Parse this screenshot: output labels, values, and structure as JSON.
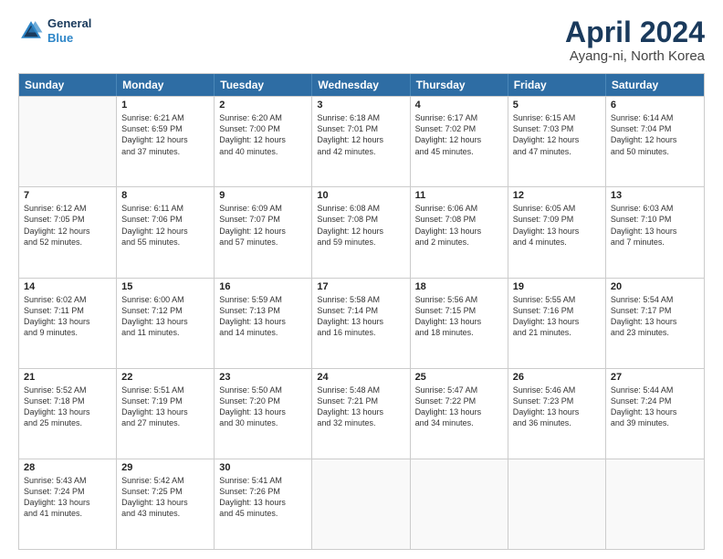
{
  "header": {
    "logo_line1": "General",
    "logo_line2": "Blue",
    "title": "April 2024",
    "subtitle": "Ayang-ni, North Korea"
  },
  "weekdays": [
    "Sunday",
    "Monday",
    "Tuesday",
    "Wednesday",
    "Thursday",
    "Friday",
    "Saturday"
  ],
  "weeks": [
    [
      {
        "day": "",
        "lines": []
      },
      {
        "day": "1",
        "lines": [
          "Sunrise: 6:21 AM",
          "Sunset: 6:59 PM",
          "Daylight: 12 hours",
          "and 37 minutes."
        ]
      },
      {
        "day": "2",
        "lines": [
          "Sunrise: 6:20 AM",
          "Sunset: 7:00 PM",
          "Daylight: 12 hours",
          "and 40 minutes."
        ]
      },
      {
        "day": "3",
        "lines": [
          "Sunrise: 6:18 AM",
          "Sunset: 7:01 PM",
          "Daylight: 12 hours",
          "and 42 minutes."
        ]
      },
      {
        "day": "4",
        "lines": [
          "Sunrise: 6:17 AM",
          "Sunset: 7:02 PM",
          "Daylight: 12 hours",
          "and 45 minutes."
        ]
      },
      {
        "day": "5",
        "lines": [
          "Sunrise: 6:15 AM",
          "Sunset: 7:03 PM",
          "Daylight: 12 hours",
          "and 47 minutes."
        ]
      },
      {
        "day": "6",
        "lines": [
          "Sunrise: 6:14 AM",
          "Sunset: 7:04 PM",
          "Daylight: 12 hours",
          "and 50 minutes."
        ]
      }
    ],
    [
      {
        "day": "7",
        "lines": [
          "Sunrise: 6:12 AM",
          "Sunset: 7:05 PM",
          "Daylight: 12 hours",
          "and 52 minutes."
        ]
      },
      {
        "day": "8",
        "lines": [
          "Sunrise: 6:11 AM",
          "Sunset: 7:06 PM",
          "Daylight: 12 hours",
          "and 55 minutes."
        ]
      },
      {
        "day": "9",
        "lines": [
          "Sunrise: 6:09 AM",
          "Sunset: 7:07 PM",
          "Daylight: 12 hours",
          "and 57 minutes."
        ]
      },
      {
        "day": "10",
        "lines": [
          "Sunrise: 6:08 AM",
          "Sunset: 7:08 PM",
          "Daylight: 12 hours",
          "and 59 minutes."
        ]
      },
      {
        "day": "11",
        "lines": [
          "Sunrise: 6:06 AM",
          "Sunset: 7:08 PM",
          "Daylight: 13 hours",
          "and 2 minutes."
        ]
      },
      {
        "day": "12",
        "lines": [
          "Sunrise: 6:05 AM",
          "Sunset: 7:09 PM",
          "Daylight: 13 hours",
          "and 4 minutes."
        ]
      },
      {
        "day": "13",
        "lines": [
          "Sunrise: 6:03 AM",
          "Sunset: 7:10 PM",
          "Daylight: 13 hours",
          "and 7 minutes."
        ]
      }
    ],
    [
      {
        "day": "14",
        "lines": [
          "Sunrise: 6:02 AM",
          "Sunset: 7:11 PM",
          "Daylight: 13 hours",
          "and 9 minutes."
        ]
      },
      {
        "day": "15",
        "lines": [
          "Sunrise: 6:00 AM",
          "Sunset: 7:12 PM",
          "Daylight: 13 hours",
          "and 11 minutes."
        ]
      },
      {
        "day": "16",
        "lines": [
          "Sunrise: 5:59 AM",
          "Sunset: 7:13 PM",
          "Daylight: 13 hours",
          "and 14 minutes."
        ]
      },
      {
        "day": "17",
        "lines": [
          "Sunrise: 5:58 AM",
          "Sunset: 7:14 PM",
          "Daylight: 13 hours",
          "and 16 minutes."
        ]
      },
      {
        "day": "18",
        "lines": [
          "Sunrise: 5:56 AM",
          "Sunset: 7:15 PM",
          "Daylight: 13 hours",
          "and 18 minutes."
        ]
      },
      {
        "day": "19",
        "lines": [
          "Sunrise: 5:55 AM",
          "Sunset: 7:16 PM",
          "Daylight: 13 hours",
          "and 21 minutes."
        ]
      },
      {
        "day": "20",
        "lines": [
          "Sunrise: 5:54 AM",
          "Sunset: 7:17 PM",
          "Daylight: 13 hours",
          "and 23 minutes."
        ]
      }
    ],
    [
      {
        "day": "21",
        "lines": [
          "Sunrise: 5:52 AM",
          "Sunset: 7:18 PM",
          "Daylight: 13 hours",
          "and 25 minutes."
        ]
      },
      {
        "day": "22",
        "lines": [
          "Sunrise: 5:51 AM",
          "Sunset: 7:19 PM",
          "Daylight: 13 hours",
          "and 27 minutes."
        ]
      },
      {
        "day": "23",
        "lines": [
          "Sunrise: 5:50 AM",
          "Sunset: 7:20 PM",
          "Daylight: 13 hours",
          "and 30 minutes."
        ]
      },
      {
        "day": "24",
        "lines": [
          "Sunrise: 5:48 AM",
          "Sunset: 7:21 PM",
          "Daylight: 13 hours",
          "and 32 minutes."
        ]
      },
      {
        "day": "25",
        "lines": [
          "Sunrise: 5:47 AM",
          "Sunset: 7:22 PM",
          "Daylight: 13 hours",
          "and 34 minutes."
        ]
      },
      {
        "day": "26",
        "lines": [
          "Sunrise: 5:46 AM",
          "Sunset: 7:23 PM",
          "Daylight: 13 hours",
          "and 36 minutes."
        ]
      },
      {
        "day": "27",
        "lines": [
          "Sunrise: 5:44 AM",
          "Sunset: 7:24 PM",
          "Daylight: 13 hours",
          "and 39 minutes."
        ]
      }
    ],
    [
      {
        "day": "28",
        "lines": [
          "Sunrise: 5:43 AM",
          "Sunset: 7:24 PM",
          "Daylight: 13 hours",
          "and 41 minutes."
        ]
      },
      {
        "day": "29",
        "lines": [
          "Sunrise: 5:42 AM",
          "Sunset: 7:25 PM",
          "Daylight: 13 hours",
          "and 43 minutes."
        ]
      },
      {
        "day": "30",
        "lines": [
          "Sunrise: 5:41 AM",
          "Sunset: 7:26 PM",
          "Daylight: 13 hours",
          "and 45 minutes."
        ]
      },
      {
        "day": "",
        "lines": []
      },
      {
        "day": "",
        "lines": []
      },
      {
        "day": "",
        "lines": []
      },
      {
        "day": "",
        "lines": []
      }
    ]
  ]
}
